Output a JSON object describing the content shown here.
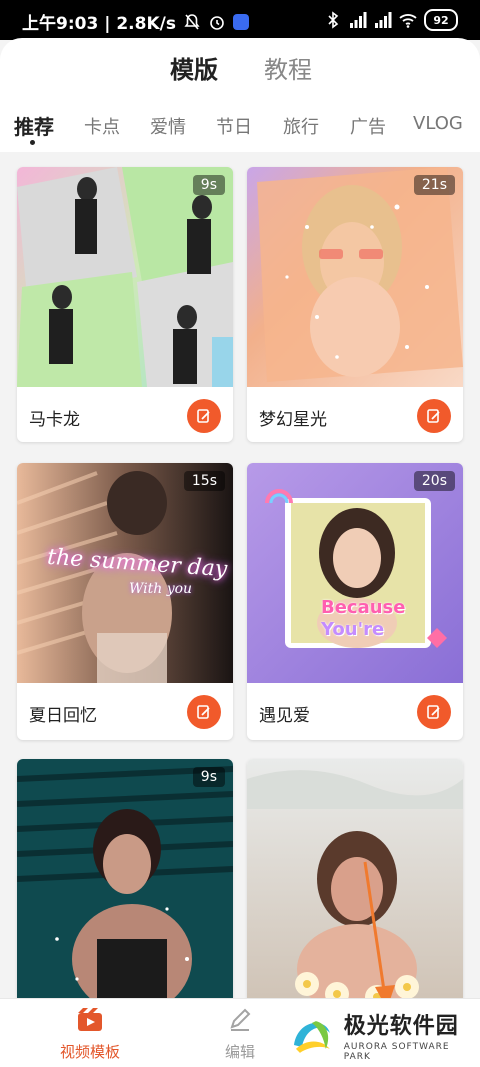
{
  "status_bar": {
    "time_speed": "上午9:03 | 2.8K/s",
    "battery": "92"
  },
  "top_tabs": [
    {
      "label": "模版",
      "active": true
    },
    {
      "label": "教程",
      "active": false
    }
  ],
  "categories": [
    {
      "label": "推荐",
      "active": true
    },
    {
      "label": "卡点",
      "active": false
    },
    {
      "label": "爱情",
      "active": false
    },
    {
      "label": "节日",
      "active": false
    },
    {
      "label": "旅行",
      "active": false
    },
    {
      "label": "广告",
      "active": false
    },
    {
      "label": "VLOG",
      "active": false
    }
  ],
  "templates": [
    {
      "title": "马卡龙",
      "duration": "9s"
    },
    {
      "title": "梦幻星光",
      "duration": "21s"
    },
    {
      "title": "夏日回忆",
      "duration": "15s",
      "overlay_text": "the summer day",
      "overlay_sub": "With you"
    },
    {
      "title": "遇见爱",
      "duration": "20s",
      "overlay_text_1": "Because",
      "overlay_text_2": "You're"
    },
    {
      "title": "",
      "duration": "9s"
    },
    {
      "title": "",
      "duration": ""
    }
  ],
  "bottom_nav": [
    {
      "label": "视频模板",
      "active": true
    },
    {
      "label": "编辑",
      "active": false
    }
  ],
  "watermark": {
    "title": "极光软件园",
    "subtitle": "AURORA SOFTWARE PARK"
  },
  "colors": {
    "accent": "#f15a2b",
    "nav_active": "#e3572b"
  }
}
